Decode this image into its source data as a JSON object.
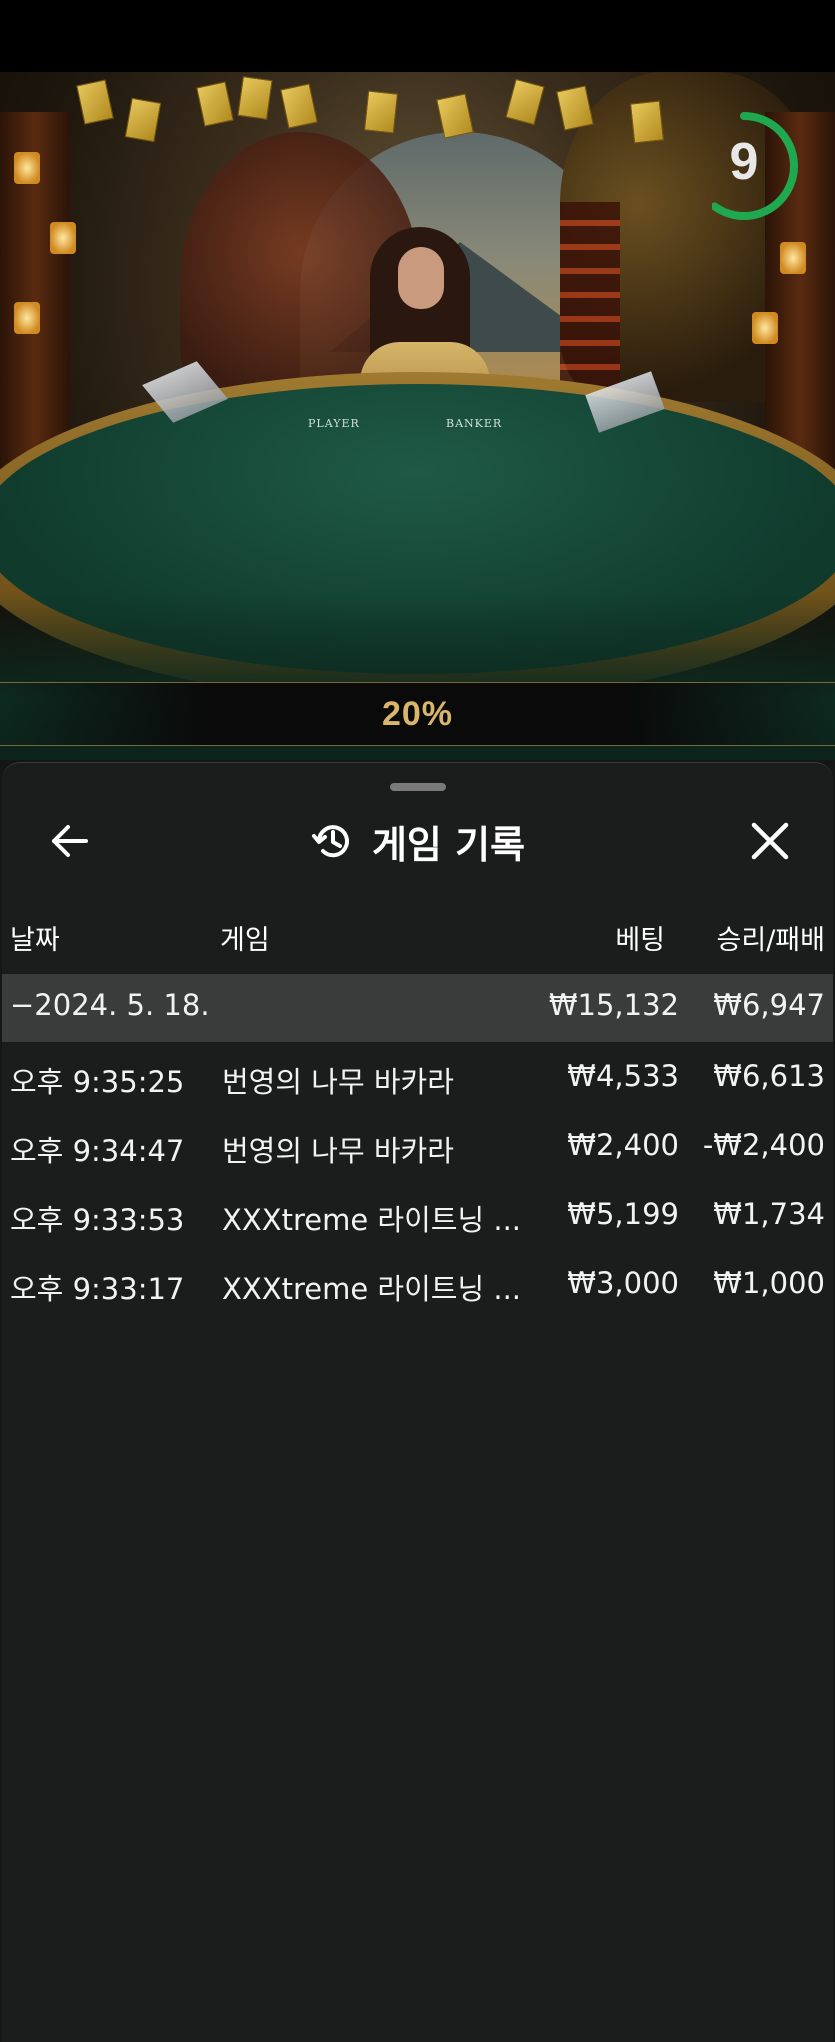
{
  "stream": {
    "felt_labels": {
      "player": "PLAYER",
      "banker": "BANKER"
    },
    "timer": {
      "value": "9",
      "progress_fraction": 0.6,
      "color": "#1fa84f"
    },
    "percent_label": "20%"
  },
  "sheet": {
    "title": "게임 기록",
    "icons": {
      "back": "arrow-left-icon",
      "history": "history-icon",
      "close": "close-icon"
    },
    "columns": {
      "date": "날짜",
      "game": "게임",
      "bet": "베팅",
      "result": "승리/패배"
    },
    "date_group": {
      "label": "−2024. 5. 18.",
      "bet": "₩15,132",
      "result": "₩6,947"
    },
    "rows": [
      {
        "time": "오후 9:35:25",
        "game": "번영의 나무 바카라",
        "bet": "₩4,533",
        "result": "₩6,613"
      },
      {
        "time": "오후 9:34:47",
        "game": "번영의 나무 바카라",
        "bet": "₩2,400",
        "result": "-₩2,400"
      },
      {
        "time": "오후 9:33:53",
        "game": "XXXtreme 라이트닝 ...",
        "bet": "₩5,199",
        "result": "₩1,734"
      },
      {
        "time": "오후 9:33:17",
        "game": "XXXtreme 라이트닝 ...",
        "bet": "₩3,000",
        "result": "₩1,000"
      }
    ]
  }
}
